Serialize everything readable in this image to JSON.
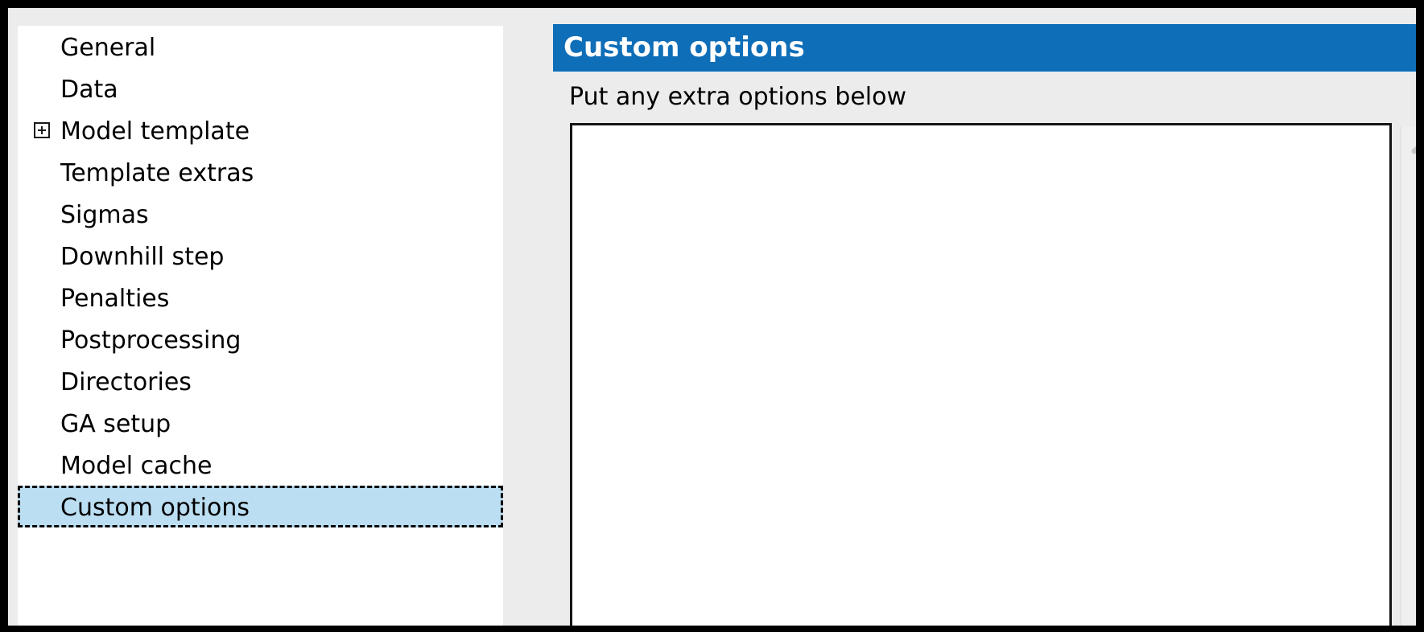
{
  "window": {
    "title": "Custom options"
  },
  "sidebar": {
    "items": [
      {
        "label": "General",
        "expandable": false,
        "selected": false
      },
      {
        "label": "Data",
        "expandable": false,
        "selected": false
      },
      {
        "label": "Model template",
        "expandable": true,
        "selected": false
      },
      {
        "label": "Template extras",
        "expandable": false,
        "selected": false
      },
      {
        "label": "Sigmas",
        "expandable": false,
        "selected": false
      },
      {
        "label": "Downhill step",
        "expandable": false,
        "selected": false
      },
      {
        "label": "Penalties",
        "expandable": false,
        "selected": false
      },
      {
        "label": "Postprocessing",
        "expandable": false,
        "selected": false
      },
      {
        "label": "Directories",
        "expandable": false,
        "selected": false
      },
      {
        "label": "GA setup",
        "expandable": false,
        "selected": false
      },
      {
        "label": "Model cache",
        "expandable": false,
        "selected": false
      },
      {
        "label": "Custom options",
        "expandable": false,
        "selected": true
      }
    ],
    "expander_icon": "plus-box-icon"
  },
  "content": {
    "banner_title": "Custom options",
    "field_label": "Put any extra options below",
    "textarea_value": "",
    "textarea_placeholder": "",
    "scroll_up_icon": "chevron-up-icon"
  },
  "colors": {
    "banner_blue": "#0E6EB8",
    "selection_blue": "#BCDEF2",
    "surface_gray": "#ECECEC",
    "panel_white": "#FFFFFF",
    "frame_black": "#000000",
    "scrollbar_gray": "#EFEFEF",
    "chevron_gray": "#C7C7C7"
  }
}
